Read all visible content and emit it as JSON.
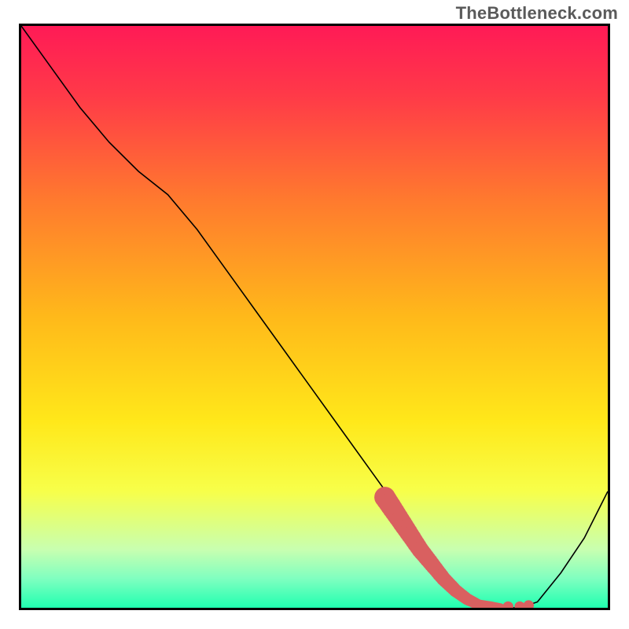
{
  "watermark": "TheBottleneck.com",
  "chart_data": {
    "type": "line",
    "title": "",
    "xlabel": "",
    "ylabel": "",
    "xlim": [
      0,
      100
    ],
    "ylim": [
      0,
      100
    ],
    "grid": false,
    "series": [
      {
        "name": "bottleneck-curve",
        "x": [
          0,
          5,
          10,
          15,
          20,
          25,
          30,
          35,
          40,
          45,
          50,
          55,
          60,
          65,
          68,
          70,
          72,
          75,
          78,
          80,
          82,
          85,
          88,
          92,
          96,
          100
        ],
        "y": [
          100,
          93,
          86,
          80,
          75,
          71,
          65,
          58,
          51,
          44,
          37,
          30,
          23,
          16,
          12,
          9,
          6,
          3,
          1,
          0.5,
          0,
          0,
          1,
          6,
          12,
          20
        ]
      }
    ],
    "highlight": {
      "name": "optimal-range",
      "description": "thick salmon segment marking the minimum / zero-bottleneck region",
      "x": [
        62,
        64,
        66,
        68,
        70,
        72,
        74,
        76,
        78,
        80,
        82
      ],
      "y": [
        19,
        16,
        13,
        10,
        7.5,
        5,
        3,
        1.5,
        0.5,
        0.3,
        0
      ]
    },
    "background": {
      "type": "vertical-gradient",
      "stops": [
        {
          "offset": 0.0,
          "color": "#ff1a56"
        },
        {
          "offset": 0.12,
          "color": "#ff3a48"
        },
        {
          "offset": 0.3,
          "color": "#ff7a2e"
        },
        {
          "offset": 0.5,
          "color": "#ffb91a"
        },
        {
          "offset": 0.68,
          "color": "#ffe81a"
        },
        {
          "offset": 0.8,
          "color": "#f7ff4a"
        },
        {
          "offset": 0.9,
          "color": "#c8ffb0"
        },
        {
          "offset": 0.95,
          "color": "#7fffc0"
        },
        {
          "offset": 1.0,
          "color": "#20ffb0"
        }
      ]
    }
  }
}
